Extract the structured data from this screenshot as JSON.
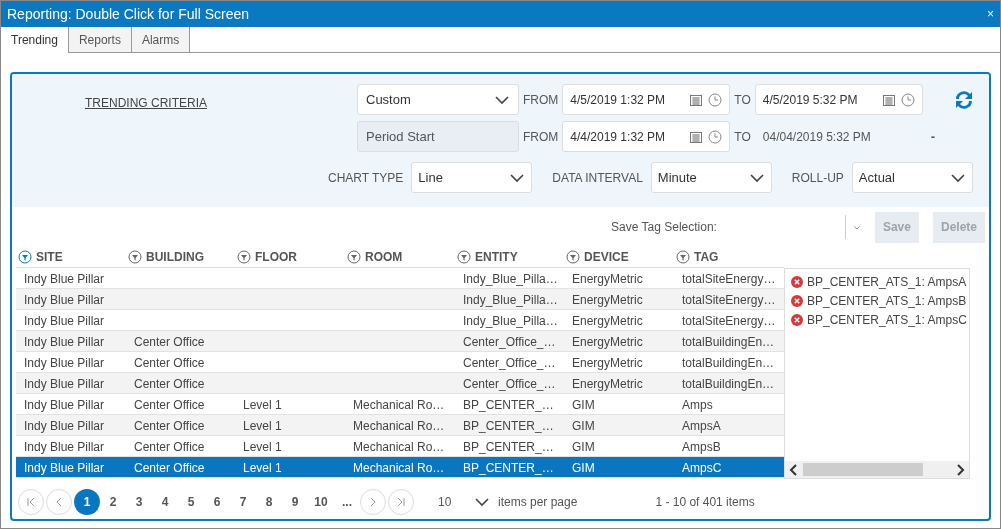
{
  "window": {
    "title": "Reporting: Double Click for Full Screen",
    "close": "×"
  },
  "tabs": [
    {
      "label": "Trending",
      "selected": true
    },
    {
      "label": "Reports",
      "selected": false
    },
    {
      "label": "Alarms",
      "selected": false
    }
  ],
  "criteria": {
    "link": "TRENDING CRITERIA",
    "range": {
      "select": "Custom",
      "from_label": "FROM",
      "from_value": "4/5/2019 1:32 PM",
      "to_label": "TO",
      "to_value": "4/5/2019 5:32 PM"
    },
    "compare": {
      "select": "Period Start",
      "from_label": "FROM",
      "from_value": "4/4/2019 1:32 PM",
      "to_label": "TO",
      "to_value": "04/04/2019 5:32 PM",
      "mark": "-"
    },
    "options": [
      {
        "label": "CHART TYPE",
        "value": "Line"
      },
      {
        "label": "DATA INTERVAL",
        "value": "Minute"
      },
      {
        "label": "ROLL-UP",
        "value": "Actual"
      }
    ]
  },
  "tag_selection": {
    "label": "Save Tag Selection:",
    "buttons": [
      {
        "label": "Save",
        "disabled": true
      },
      {
        "label": "Delete",
        "disabled": true
      }
    ]
  },
  "table": {
    "columns": [
      "SITE",
      "BUILDING",
      "FLOOR",
      "ROOM",
      "ENTITY",
      "DEVICE",
      "TAG"
    ],
    "rows": [
      {
        "cells": [
          "Indy Blue Pillar",
          "",
          "",
          "",
          "Indy_Blue_Pilla…",
          "EnergyMetric",
          "totalSiteEnergy…"
        ],
        "selected": false
      },
      {
        "cells": [
          "Indy Blue Pillar",
          "",
          "",
          "",
          "Indy_Blue_Pilla…",
          "EnergyMetric",
          "totalSiteEnergy…"
        ],
        "selected": false
      },
      {
        "cells": [
          "Indy Blue Pillar",
          "",
          "",
          "",
          "Indy_Blue_Pilla…",
          "EnergyMetric",
          "totalSiteEnergy…"
        ],
        "selected": false
      },
      {
        "cells": [
          "Indy Blue Pillar",
          "Center Office",
          "",
          "",
          "Center_Office_…",
          "EnergyMetric",
          "totalBuildingEn…"
        ],
        "selected": false
      },
      {
        "cells": [
          "Indy Blue Pillar",
          "Center Office",
          "",
          "",
          "Center_Office_…",
          "EnergyMetric",
          "totalBuildingEn…"
        ],
        "selected": false
      },
      {
        "cells": [
          "Indy Blue Pillar",
          "Center Office",
          "",
          "",
          "Center_Office_…",
          "EnergyMetric",
          "totalBuildingEn…"
        ],
        "selected": false
      },
      {
        "cells": [
          "Indy Blue Pillar",
          "Center Office",
          "Level 1",
          "Mechanical Ro…",
          "BP_CENTER_…",
          "GIM",
          "Amps"
        ],
        "selected": false
      },
      {
        "cells": [
          "Indy Blue Pillar",
          "Center Office",
          "Level 1",
          "Mechanical Ro…",
          "BP_CENTER_…",
          "GIM",
          "AmpsA"
        ],
        "selected": false
      },
      {
        "cells": [
          "Indy Blue Pillar",
          "Center Office",
          "Level 1",
          "Mechanical Ro…",
          "BP_CENTER_…",
          "GIM",
          "AmpsB"
        ],
        "selected": false
      },
      {
        "cells": [
          "Indy Blue Pillar",
          "Center Office",
          "Level 1",
          "Mechanical Ro…",
          "BP_CENTER_…",
          "GIM",
          "AmpsC"
        ],
        "selected": true
      }
    ]
  },
  "selected_tags": [
    "BP_CENTER_ATS_1: AmpsA",
    "BP_CENTER_ATS_1: AmpsB",
    "BP_CENTER_ATS_1: AmpsC"
  ],
  "pager": {
    "pages": [
      {
        "label": "1",
        "selected": true
      },
      {
        "label": "2",
        "selected": false
      },
      {
        "label": "3",
        "selected": false
      },
      {
        "label": "4",
        "selected": false
      },
      {
        "label": "5",
        "selected": false
      },
      {
        "label": "6",
        "selected": false
      },
      {
        "label": "7",
        "selected": false
      },
      {
        "label": "8",
        "selected": false
      },
      {
        "label": "9",
        "selected": false
      },
      {
        "label": "10",
        "selected": false
      }
    ],
    "more": "...",
    "page_size": "10",
    "page_size_label": "items per page",
    "summary": "1 - 10 of 401 items"
  }
}
